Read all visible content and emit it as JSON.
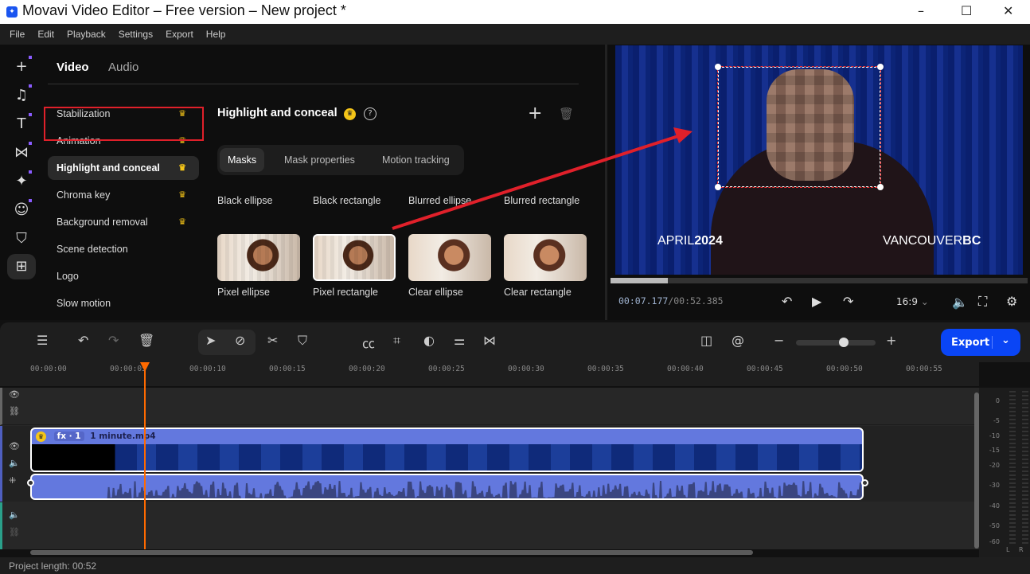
{
  "window": {
    "title": "Movavi Video Editor – Free version – New project *",
    "logo": "movavi-logo",
    "minimize": "–",
    "maximize": "☐",
    "close": "✕"
  },
  "menu": [
    "File",
    "Edit",
    "Playback",
    "Settings",
    "Export",
    "Help"
  ],
  "sidebar_icons": [
    "plus-icon",
    "music-icon",
    "text-icon",
    "transition-icon",
    "magic-icon",
    "sticker-icon",
    "bag-icon",
    "more-tools-icon"
  ],
  "tabs": {
    "video": "Video",
    "audio": "Audio"
  },
  "categories": [
    {
      "label": "Stabilization",
      "premium": true
    },
    {
      "label": "Animation",
      "premium": true
    },
    {
      "label": "Highlight and conceal",
      "premium": true,
      "selected": true
    },
    {
      "label": "Chroma key",
      "premium": true
    },
    {
      "label": "Background removal",
      "premium": true
    },
    {
      "label": "Scene detection",
      "premium": false
    },
    {
      "label": "Logo",
      "premium": false
    },
    {
      "label": "Slow motion",
      "premium": false
    }
  ],
  "panel": {
    "title": "Highlight and conceal",
    "subtabs": [
      "Masks",
      "Mask properties",
      "Motion tracking"
    ],
    "active_subtab": "Masks",
    "masks_row1": [
      "Black ellipse",
      "Black rectangle",
      "Blurred ellipse",
      "Blurred rectangle"
    ],
    "masks_row2": [
      "Pixel ellipse",
      "Pixel rectangle",
      "Clear ellipse",
      "Clear rectangle"
    ],
    "selected_mask": "Pixel rectangle"
  },
  "preview": {
    "overlay_left": "APRIL",
    "overlay_left_bold": "2024",
    "overlay_right": "VANCOUVER",
    "overlay_right_bold": "BC",
    "progress": 0.137,
    "time_current": "00:07.177",
    "time_total": "/00:52.385",
    "aspect": "16:9"
  },
  "annotation_color": "#e0202a",
  "timeline": {
    "export_label": "Export",
    "ruler": [
      "00:00:00",
      "00:00:05",
      "00:00:10",
      "00:00:15",
      "00:00:20",
      "00:00:25",
      "00:00:30",
      "00:00:35",
      "00:00:40",
      "00:00:45",
      "00:00:50",
      "00:00:55"
    ],
    "clip": {
      "fx": "fx · 1",
      "name": "1 minute.mp4"
    },
    "playhead": "00:00:07.177",
    "zoom_level": 0.6
  },
  "meter": {
    "scale": [
      "0",
      "-5",
      "-10",
      "-15",
      "-20",
      "-30",
      "-40",
      "-50",
      "-60"
    ],
    "channels": [
      "L",
      "R"
    ]
  },
  "status": {
    "project_length": "Project length: 00:52"
  },
  "accent": "#0a45f5"
}
